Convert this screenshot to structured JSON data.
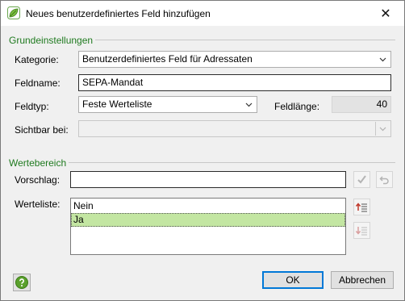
{
  "window": {
    "title": "Neues benutzerdefiniertes Feld hinzufügen",
    "app_icon": "leaf-app-icon",
    "close_glyph": "✕"
  },
  "grundeinstellungen": {
    "heading": "Grundeinstellungen",
    "kategorie_label": "Kategorie:",
    "kategorie_value": "Benutzerdefiniertes Feld für Adressaten",
    "feldname_label": "Feldname:",
    "feldname_value": "SEPA-Mandat",
    "feldtyp_label": "Feldtyp:",
    "feldtyp_value": "Feste Werteliste",
    "feldlaenge_label": "Feldlänge:",
    "feldlaenge_value": "40",
    "sichtbar_label": "Sichtbar bei:",
    "sichtbar_value": ""
  },
  "wertebereich": {
    "heading": "Wertebereich",
    "vorschlag_label": "Vorschlag:",
    "vorschlag_value": "",
    "werteliste_label": "Werteliste:",
    "items": [
      "Nein",
      "Ja"
    ],
    "selected_index": 1,
    "selected_color": "#c3e6a2"
  },
  "buttons": {
    "ok": "OK",
    "cancel": "Abbrechen"
  }
}
